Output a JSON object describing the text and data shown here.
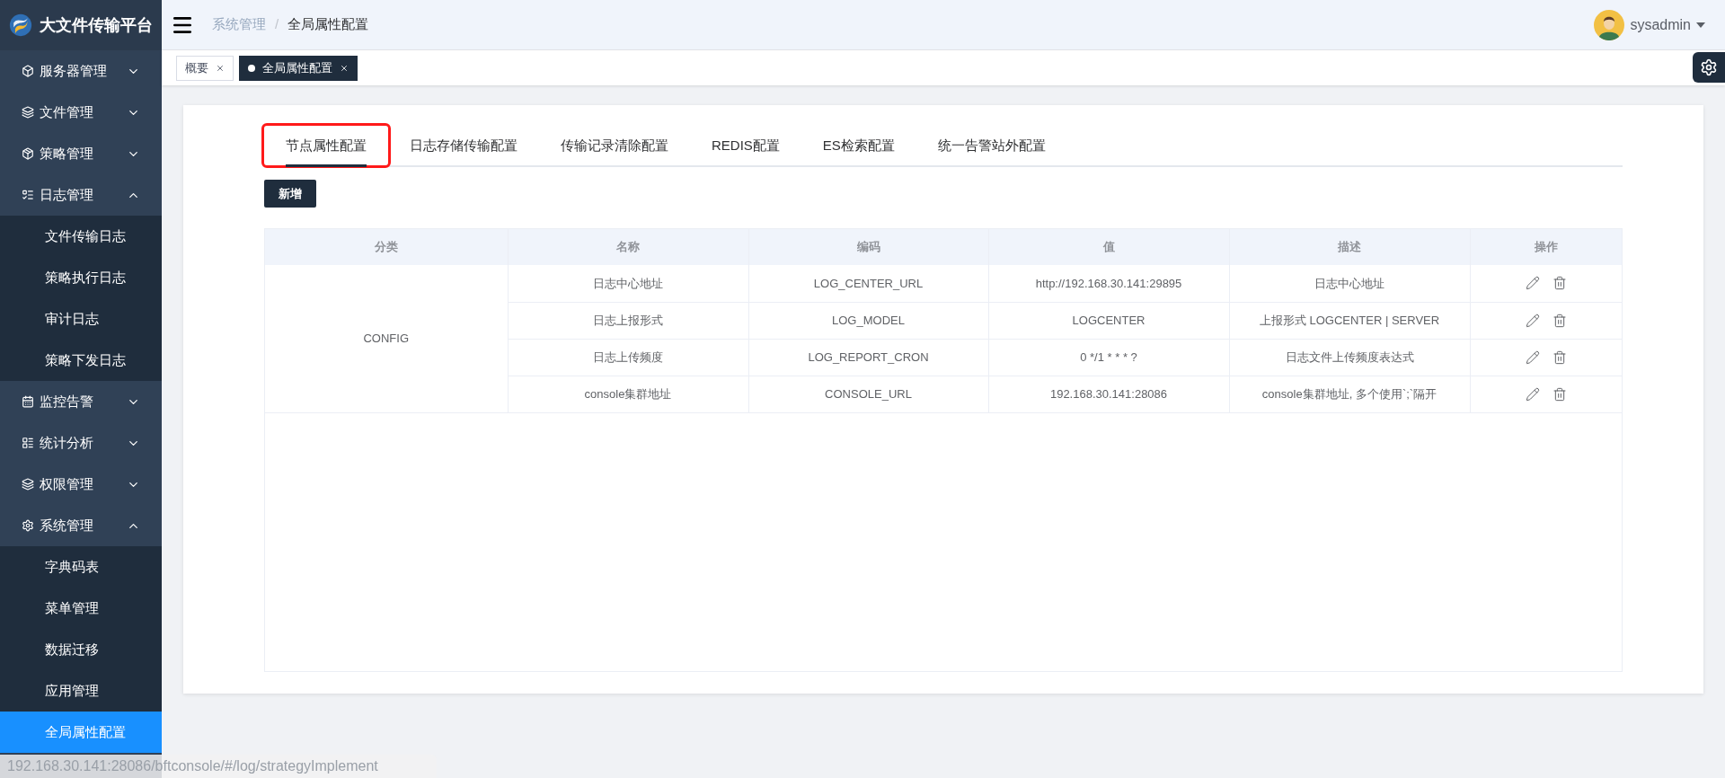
{
  "brand": {
    "title": "大文件传输平台"
  },
  "sidebar": {
    "items": [
      {
        "label": "服务器管理",
        "expanded": false
      },
      {
        "label": "文件管理",
        "expanded": false
      },
      {
        "label": "策略管理",
        "expanded": false
      },
      {
        "label": "日志管理",
        "expanded": true,
        "children": [
          {
            "label": "文件传输日志",
            "selected": false
          },
          {
            "label": "策略执行日志",
            "selected": false
          },
          {
            "label": "审计日志",
            "selected": false
          },
          {
            "label": "策略下发日志",
            "selected": false
          }
        ]
      },
      {
        "label": "监控告警",
        "expanded": false
      },
      {
        "label": "统计分析",
        "expanded": false
      },
      {
        "label": "权限管理",
        "expanded": false
      },
      {
        "label": "系统管理",
        "expanded": true,
        "children": [
          {
            "label": "字典码表",
            "selected": false
          },
          {
            "label": "菜单管理",
            "selected": false
          },
          {
            "label": "数据迁移",
            "selected": false
          },
          {
            "label": "应用管理",
            "selected": false
          },
          {
            "label": "全局属性配置",
            "selected": true
          }
        ]
      }
    ]
  },
  "breadcrumb": [
    "系统管理",
    "全局属性配置"
  ],
  "breadcrumb_separator": "/",
  "user": {
    "name": "sysadmin"
  },
  "open_tags": [
    {
      "label": "概要",
      "selected": false
    },
    {
      "label": "全局属性配置",
      "selected": true
    }
  ],
  "tabs": [
    {
      "label": "节点属性配置",
      "selected": true,
      "highlighted": true
    },
    {
      "label": "日志存储传输配置",
      "selected": false,
      "highlighted": false
    },
    {
      "label": "传输记录清除配置",
      "selected": false,
      "highlighted": false
    },
    {
      "label": "REDIS配置",
      "selected": false,
      "highlighted": false
    },
    {
      "label": "ES检索配置",
      "selected": false,
      "highlighted": false
    },
    {
      "label": "统一告警站外配置",
      "selected": false,
      "highlighted": false
    }
  ],
  "add_button": "新增",
  "table": {
    "columns": [
      "分类",
      "名称",
      "编码",
      "值",
      "描述",
      "操作"
    ],
    "groups": [
      {
        "category": "CONFIG",
        "rows": [
          {
            "name": "日志中心地址",
            "code": "LOG_CENTER_URL",
            "value": "http://192.168.30.141:29895",
            "description": "日志中心地址"
          },
          {
            "name": "日志上报形式",
            "code": "LOG_MODEL",
            "value": "LOGCENTER",
            "description": "上报形式 LOGCENTER | SERVER"
          },
          {
            "name": "日志上传频度",
            "code": "LOG_REPORT_CRON",
            "value": "0 */1 * * * ?",
            "description": "日志文件上传频度表达式"
          },
          {
            "name": "console集群地址",
            "code": "CONSOLE_URL",
            "value": "192.168.30.141:28086",
            "description": "console集群地址, 多个使用`;`隔开"
          }
        ]
      }
    ]
  },
  "status_bar": {
    "url": "192.168.30.141:28086/bftconsole/#/log/strategyImplement"
  }
}
